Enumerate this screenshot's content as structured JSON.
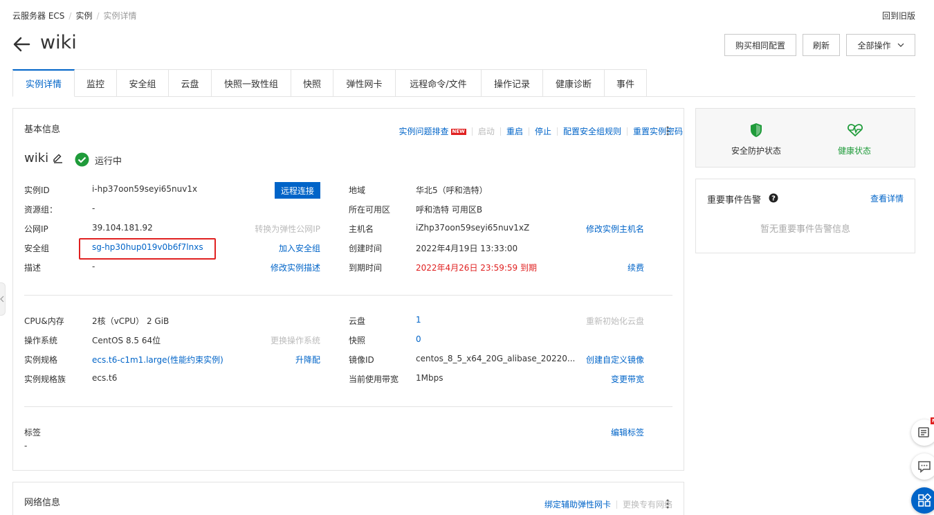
{
  "breadcrumb": {
    "item1": "云服务器 ECS",
    "item2": "实例",
    "current": "实例详情"
  },
  "old_version": "回到旧版",
  "title": "wiki",
  "buttons": {
    "buy_same": "购买相同配置",
    "refresh": "刷新",
    "all_actions": "全部操作"
  },
  "tabs": [
    "实例详情",
    "监控",
    "安全组",
    "云盘",
    "快照一致性组",
    "快照",
    "弹性网卡",
    "远程命令/文件",
    "操作记录",
    "健康诊断",
    "事件"
  ],
  "basic": {
    "title": "基本信息",
    "actions": {
      "troubleshoot": "实例问题排查",
      "new_badge": "NEW",
      "start": "启动",
      "restart": "重启",
      "stop": "停止",
      "sg_rules": "配置安全组规则",
      "reset_pwd": "重置实例密码"
    },
    "name": "wiki",
    "status": "运行中",
    "remote_btn": "远程连接",
    "left": {
      "instance_id_label": "实例ID",
      "instance_id": "i-hp37oon59seyi65nuv1x",
      "resource_group_label": "资源组：",
      "resource_group": "-",
      "public_ip_label": "公网IP",
      "public_ip": "39.104.181.92",
      "convert_eip": "转换为弹性公网IP",
      "sg_label": "安全组",
      "sg": "sg-hp30hup019v0b6f7lnxs",
      "join_sg": "加入安全组",
      "desc_label": "描述",
      "desc": "-",
      "edit_desc": "修改实例描述"
    },
    "right": {
      "region_label": "地域",
      "region": "华北5（呼和浩特）",
      "zone_label": "所在可用区",
      "zone": "呼和浩特 可用区B",
      "host_label": "主机名",
      "host": "iZhp37oon59seyi65nuv1xZ",
      "edit_host": "修改实例主机名",
      "created_label": "创建时间",
      "created": "2022年4月19日 13:33:00",
      "expire_label": "到期时间",
      "expire": "2022年4月26日 23:59:59 到期",
      "renew": "续费"
    },
    "spec": {
      "cpu_label": "CPU&内存",
      "cpu": "2核（vCPU） 2 GiB",
      "os_label": "操作系统",
      "os": "CentOS 8.5 64位",
      "change_os": "更换操作系统",
      "type_label": "实例规格",
      "type": "ecs.t6-c1m1.large(性能约束实例)",
      "resize": "升降配",
      "family_label": "实例规格族",
      "family": "ecs.t6",
      "disk_label": "云盘",
      "disk": "1",
      "reinit": "重新初始化云盘",
      "snap_label": "快照",
      "snap": "0",
      "image_label": "镜像ID",
      "image": "centos_8_5_x64_20G_alibase_20220...",
      "create_image": "创建自定义镜像",
      "bw_label": "当前使用带宽",
      "bw": "1Mbps",
      "change_bw": "变更带宽"
    },
    "tags": {
      "label": "标签",
      "value": "-",
      "edit": "编辑标签"
    }
  },
  "status_panel": {
    "security": "安全防护状态",
    "health": "健康状态"
  },
  "events_panel": {
    "title": "重要事件告警",
    "view": "查看详情",
    "empty": "暂无重要事件告警信息"
  },
  "network": {
    "title": "网络信息",
    "bind_eni": "绑定辅助弹性网卡",
    "change_vpc": "更换专有网络"
  },
  "colors": {
    "accent": "#0064c8",
    "danger": "#e02020",
    "success": "#1f9b3a"
  }
}
